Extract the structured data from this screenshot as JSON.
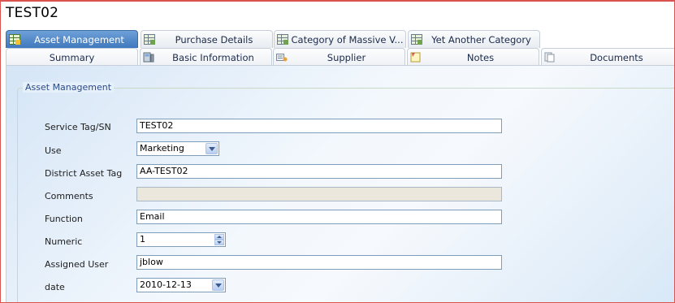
{
  "record": {
    "title": "TEST02"
  },
  "tabs_row1": [
    {
      "label": "Asset Management",
      "icon": "table-grid-icon",
      "active": true
    },
    {
      "label": "Purchase Details",
      "icon": "table-grid-icon"
    },
    {
      "label": "Category of Massive V...",
      "icon": "table-grid-icon"
    },
    {
      "label": "Yet Another Category",
      "icon": "table-grid-icon"
    }
  ],
  "tabs_row2": [
    {
      "label": "Summary",
      "icon": ""
    },
    {
      "label": "Basic Information",
      "icon": "device-icon"
    },
    {
      "label": "Supplier",
      "icon": "supplier-icon"
    },
    {
      "label": "Notes",
      "icon": "notes-icon"
    },
    {
      "label": "Documents",
      "icon": "documents-icon"
    }
  ],
  "section": {
    "legend": "Asset Management"
  },
  "fields": {
    "service_tag": {
      "label": "Service Tag/SN",
      "value": "TEST02"
    },
    "use": {
      "label": "Use",
      "value": "Marketing"
    },
    "district_asset_tag": {
      "label": "District Asset Tag",
      "value": "AA-TEST02"
    },
    "comments": {
      "label": "Comments",
      "value": ""
    },
    "function": {
      "label": "Function",
      "value": "Email"
    },
    "numeric": {
      "label": "Numeric",
      "value": "1"
    },
    "assigned_user": {
      "label": "Assigned User",
      "value": "jblow"
    },
    "date": {
      "label": "date",
      "value": "2010-12-13"
    }
  },
  "colors": {
    "active_tab": "#4a82c3",
    "frame_border": "#d9534f",
    "legend_text": "#2b4a8a"
  }
}
